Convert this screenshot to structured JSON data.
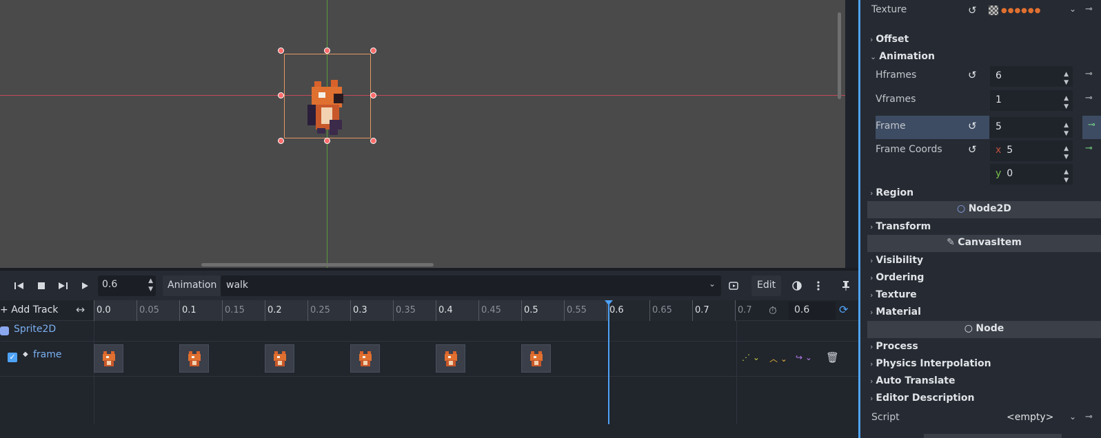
{
  "viewport": {},
  "animation_toolbar": {
    "time_value": "0.6",
    "animation_label": "Animation",
    "animation_name": "walk",
    "edit_label": "Edit"
  },
  "timeline": {
    "add_track_label": "Add Track",
    "ticks": [
      "0.0",
      "0.05",
      "0.1",
      "0.15",
      "0.2",
      "0.25",
      "0.3",
      "0.35",
      "0.4",
      "0.45",
      "0.5",
      "0.55",
      "0.6",
      "0.65",
      "0.7",
      "0.7"
    ],
    "length_value": "0.6",
    "playhead_time": 0.6,
    "tracks": {
      "node_label": "Sprite2D",
      "property_label": "frame",
      "keyframe_times": [
        0.0,
        0.1,
        0.2,
        0.3,
        0.4,
        0.5
      ]
    }
  },
  "inspector": {
    "texture_label": "Texture",
    "offset_label": "Offset",
    "animation_label": "Animation",
    "hframes_label": "Hframes",
    "hframes_value": "6",
    "vframes_label": "Vframes",
    "vframes_value": "1",
    "frame_label": "Frame",
    "frame_value": "5",
    "frame_coords_label": "Frame Coords",
    "frame_coords_x_axis": "x",
    "frame_coords_x": "5",
    "frame_coords_y_axis": "y",
    "frame_coords_y": "0",
    "region_label": "Region",
    "node2d_label": "Node2D",
    "transform_label": "Transform",
    "canvasitem_label": "CanvasItem",
    "visibility_label": "Visibility",
    "ordering_label": "Ordering",
    "texture2_label": "Texture",
    "material_label": "Material",
    "node_label": "Node",
    "process_label": "Process",
    "physics_label": "Physics Interpolation",
    "auto_translate_label": "Auto Translate",
    "editor_desc_label": "Editor Description",
    "script_label": "Script",
    "script_value": "<empty>"
  },
  "colors": {
    "accent": "#4fa3f7",
    "axis_x": "#c44a5a",
    "axis_y": "#5e9a3c",
    "selection": "#e59866"
  }
}
